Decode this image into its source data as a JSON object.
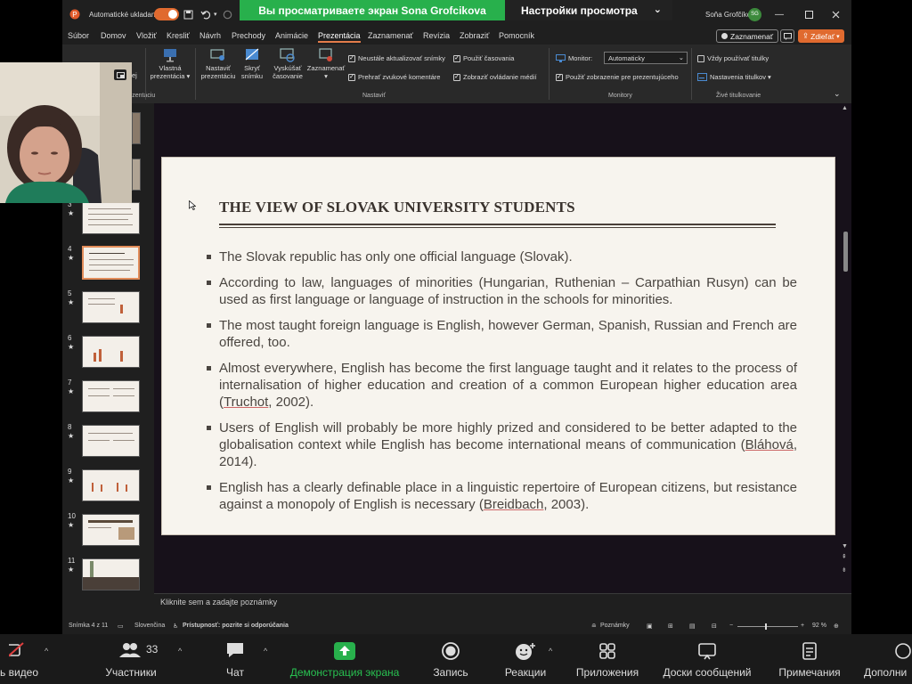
{
  "sharing_banner": "Вы просматриваете экран Sona Grofcikova",
  "view_options": "Настройки просмотра",
  "titlebar": {
    "autosave_label": "Automatické ukladanie",
    "user_name": "Soňa Grofčíková",
    "user_initials": "SG"
  },
  "menu": [
    "Súbor",
    "Domov",
    "Vložiť",
    "Kresliť",
    "Návrh",
    "Prechody",
    "Animácie",
    "Prezentácia",
    "Zaznamenať",
    "Revízia",
    "Zobraziť",
    "Pomocník"
  ],
  "menu_active": "Prezentácia",
  "record_button": "Zaznamenať",
  "share_button": "Zdieľať",
  "ribbon": {
    "partial_left": "ej",
    "custom_show": "Vlastná prezentácia",
    "setup_show": "Nastaviť prezentáciu",
    "hide_slide": "Skryť snímku",
    "rehearse": "Vyskúšať časovanie",
    "record": "Zaznamenať",
    "chk_update": "Neustále aktualizovať snímky",
    "chk_use_timing": "Použiť časovania",
    "chk_narration": "Prehrať zvukové komentáre",
    "chk_controls": "Zobraziť ovládanie médií",
    "group_setup": "Nastaviť",
    "group_start_partial": "rezentáciu",
    "monitor_label": "Monitor:",
    "monitor_value": "Automaticky",
    "presenter_view": "Použiť zobrazenie pre prezentujúceho",
    "group_monitors": "Monitory",
    "always_captions": "Vždy používať titulky",
    "caption_settings": "Nastavenia titulkov",
    "group_captions": "Živé titulkovanie"
  },
  "thumbnails": [
    {
      "num": "3",
      "star": "★"
    },
    {
      "num": "4",
      "star": "★"
    },
    {
      "num": "5",
      "star": "★"
    },
    {
      "num": "6",
      "star": "★"
    },
    {
      "num": "7",
      "star": "★"
    },
    {
      "num": "8",
      "star": "★"
    },
    {
      "num": "9",
      "star": "★"
    },
    {
      "num": "10",
      "star": "★"
    },
    {
      "num": "11",
      "star": "★"
    }
  ],
  "slide": {
    "title": "THE VIEW OF SLOVAK UNIVERSITY STUDENTS",
    "bullets": [
      {
        "text": "The Slovak republic has only one official language (Slovak).",
        "cite": "",
        "tail": ""
      },
      {
        "text": "According to law, languages of minorities (Hungarian, Ruthenian – Carpathian Rusyn) can be used as first language or language of instruction in the schools for minorities.",
        "cite": "",
        "tail": ""
      },
      {
        "text": "The most taught foreign language is English, however German, Spanish, Russian and French are offered, too.",
        "cite": "",
        "tail": ""
      },
      {
        "text": "Almost everywhere, English has become the first language taught and it relates to the process of internalisation of higher education and creation of a common European higher education area (",
        "cite": "Truchot",
        "tail": ", 2002)."
      },
      {
        "text": "Users of English will probably be more highly prized and considered to be better adapted to the globalisation context while English has become international means of communication (",
        "cite": "Bláhová",
        "tail": ", 2014)."
      },
      {
        "text": "English has a clearly definable place in a linguistic repertoire of European citizens, but resistance against a monopoly of English is necessary (",
        "cite": "Breidbach",
        "tail": ", 2003)."
      }
    ]
  },
  "notes_placeholder": "Kliknite sem a zadajte poznámky",
  "status": {
    "slide_info": "Snímka 4 z 11",
    "language": "Slovenčina",
    "accessibility": "Prístupnosť: pozrite si odporúčania",
    "notes_btn": "Poznámky",
    "zoom": "92 %"
  },
  "zoom_toolbar": {
    "video": "ь видео",
    "participants": "Участники",
    "participants_count": "33",
    "chat": "Чат",
    "share": "Демонстрация экрана",
    "record": "Запись",
    "reactions": "Реакции",
    "apps": "Приложения",
    "whiteboards": "Доски сообщений",
    "notes": "Примечания",
    "more": "Дополни"
  },
  "colors": {
    "share_green": "#28b04c",
    "accent_orange": "#e06a2f",
    "slide_bg": "#f7f4ee"
  }
}
